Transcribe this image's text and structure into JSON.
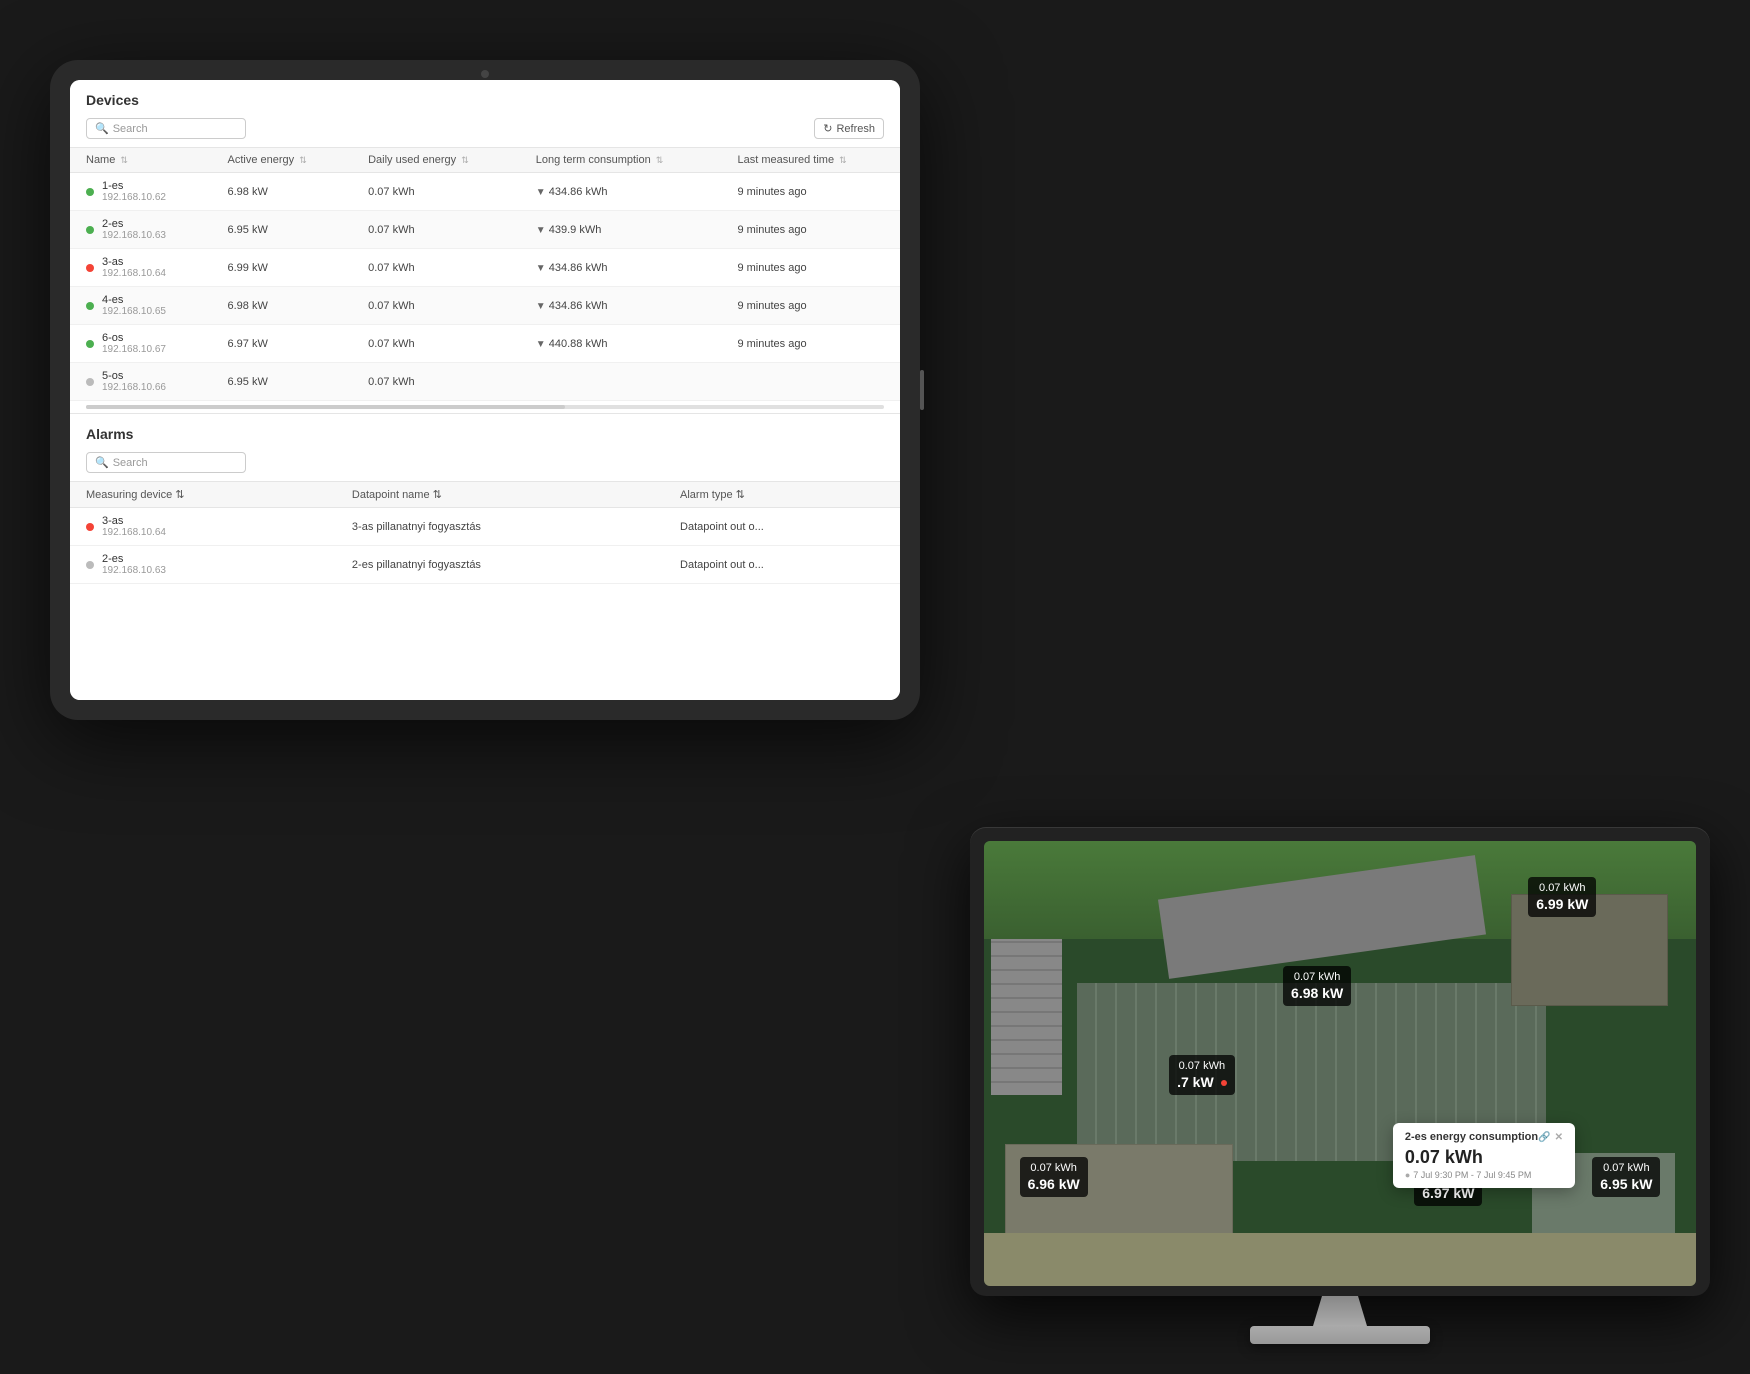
{
  "page": {
    "bg_color": "#1a1a1a"
  },
  "tablet": {
    "devices_section": {
      "title": "Devices",
      "search_placeholder": "Search",
      "refresh_label": "Refresh",
      "table": {
        "columns": [
          "Name",
          "Active energy",
          "Daily used energy",
          "Long term consumption",
          "Last measured time"
        ],
        "rows": [
          {
            "name": "1-es",
            "ip": "192.168.10.62",
            "status": "green",
            "active_energy": "6.98 kW",
            "daily_energy": "0.07 kWh",
            "long_term": "434.86 kWh",
            "last_measured": "9 minutes ago"
          },
          {
            "name": "2-es",
            "ip": "192.168.10.63",
            "status": "green",
            "active_energy": "6.95 kW",
            "daily_energy": "0.07 kWh",
            "long_term": "439.9 kWh",
            "last_measured": "9 minutes ago"
          },
          {
            "name": "3-as",
            "ip": "192.168.10.64",
            "status": "red",
            "active_energy": "6.99 kW",
            "daily_energy": "0.07 kWh",
            "long_term": "434.86 kWh",
            "last_measured": "9 minutes ago"
          },
          {
            "name": "4-es",
            "ip": "192.168.10.65",
            "status": "green",
            "active_energy": "6.98 kW",
            "daily_energy": "0.07 kWh",
            "long_term": "434.86 kWh",
            "last_measured": "9 minutes ago"
          },
          {
            "name": "6-os",
            "ip": "192.168.10.67",
            "status": "green",
            "active_energy": "6.97 kW",
            "daily_energy": "0.07 kWh",
            "long_term": "440.88 kWh",
            "last_measured": "9 minutes ago"
          },
          {
            "name": "5-os",
            "ip": "192.168.10.66",
            "status": "gray",
            "active_energy": "6.95 kW",
            "daily_energy": "0.07 kWh",
            "long_term": "",
            "last_measured": ""
          }
        ]
      }
    },
    "alarms_section": {
      "title": "Alarms",
      "search_placeholder": "Search",
      "table": {
        "columns": [
          "Measuring device",
          "Datapoint name",
          "Alarm type"
        ],
        "rows": [
          {
            "device": "3-as",
            "ip": "192.168.10.64",
            "status": "red",
            "datapoint": "3-as pillanatnyi fogyasztás",
            "alarm_type": "Datapoint out o..."
          },
          {
            "device": "2-es",
            "ip": "192.168.10.63",
            "status": "gray",
            "datapoint": "2-es pillanatnyi fogyasztás",
            "alarm_type": "Datapoint out o..."
          }
        ]
      }
    }
  },
  "monitor": {
    "energy_labels": [
      {
        "kwh": "0.07 kWh",
        "kw": "6.99 kW",
        "position": "top-right",
        "id": "label-1"
      },
      {
        "kwh": "0.07 kWh",
        "kw": "6.98 kW",
        "position": "center",
        "id": "label-2"
      },
      {
        "kwh": "0.07 kWh",
        "kw": "7 kW",
        "position": "center-left",
        "id": "label-3",
        "has_red_dot": true
      },
      {
        "kwh": "0.07 kWh",
        "kw": "6.96 kW",
        "position": "bottom-left",
        "id": "label-4"
      },
      {
        "kwh": "0.07 kWh",
        "kw": "6.97 kW",
        "position": "bottom-center",
        "id": "label-5"
      },
      {
        "kwh": "0.07 kWh",
        "kw": "6.95 kW",
        "position": "bottom-right",
        "id": "label-6"
      }
    ],
    "tooltip": {
      "title": "2-es energy consumption",
      "value": "0.07 kWh",
      "time": "7 Jul 9:30 PM - 7 Jul 9:45 PM"
    }
  }
}
